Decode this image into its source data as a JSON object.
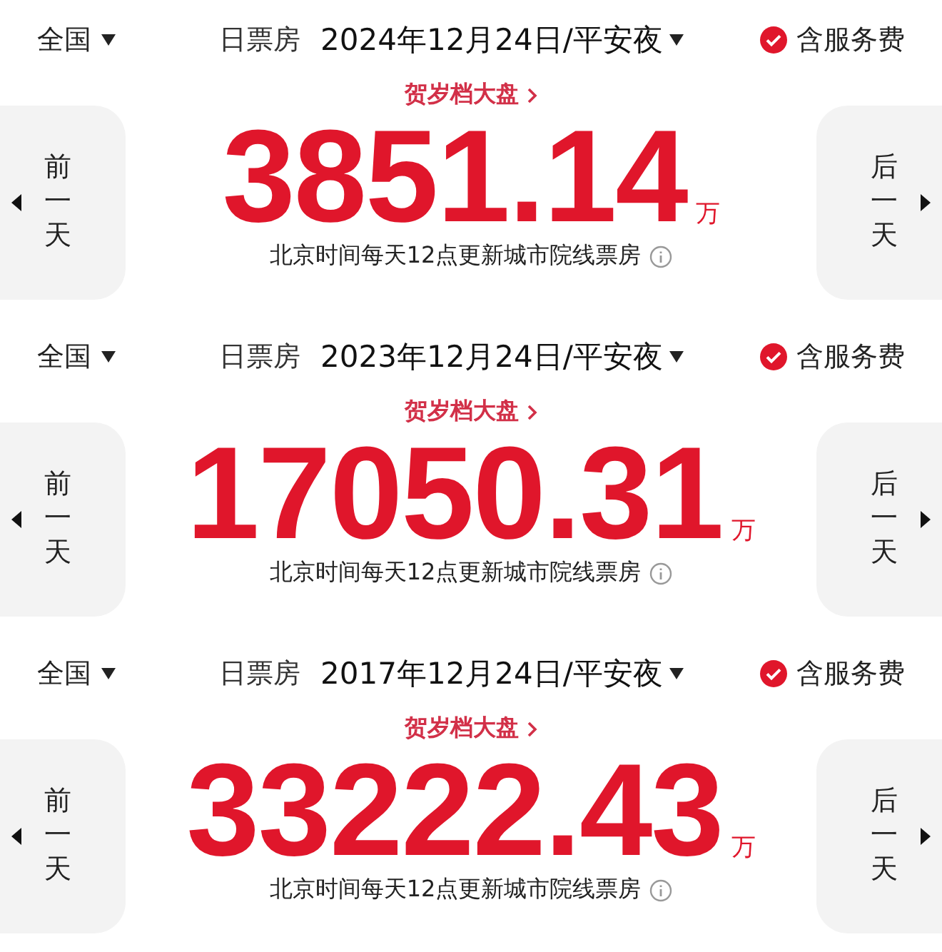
{
  "panels": [
    {
      "region": "全国",
      "title": "日票房",
      "date": "2024年12月24日/平安夜",
      "service_fee": {
        "label": "含服务费",
        "checked": true
      },
      "link": "贺岁档大盘",
      "amount": "3851.14",
      "unit": "万",
      "note": "北京时间每天12点更新城市院线票房",
      "prev": "前一天",
      "next": "后一天"
    },
    {
      "region": "全国",
      "title": "日票房",
      "date": "2023年12月24日/平安夜",
      "service_fee": {
        "label": "含服务费",
        "checked": true
      },
      "link": "贺岁档大盘",
      "amount": "17050.31",
      "unit": "万",
      "note": "北京时间每天12点更新城市院线票房",
      "prev": "前一天",
      "next": "后一天"
    },
    {
      "region": "全国",
      "title": "日票房",
      "date": "2017年12月24日/平安夜",
      "service_fee": {
        "label": "含服务费",
        "checked": true
      },
      "link": "贺岁档大盘",
      "amount": "33222.43",
      "unit": "万",
      "note": "北京时间每天12点更新城市院线票房",
      "prev": "前一天",
      "next": "后一天"
    }
  ]
}
